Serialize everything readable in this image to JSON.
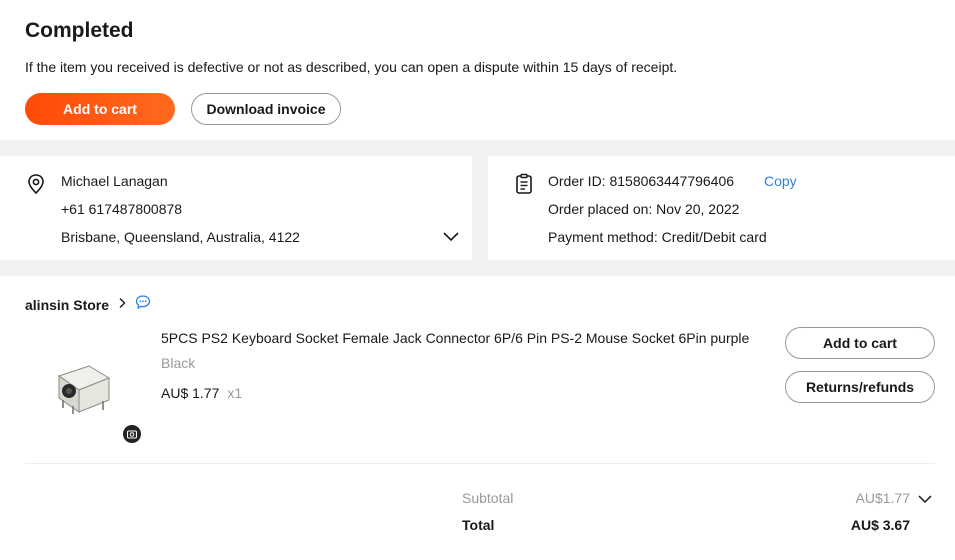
{
  "status": {
    "title": "Completed",
    "description": "If the item you received is defective or not as described, you can open a dispute within 15 days of receipt.",
    "add_to_cart_label": "Add to cart",
    "download_invoice_label": "Download invoice"
  },
  "address": {
    "name": "Michael Lanagan",
    "phone": "+61 617487800878",
    "location": "Brisbane, Queensland, Australia, 4122"
  },
  "order": {
    "order_id": "Order ID: 8158063447796406",
    "copy_label": "Copy",
    "placed_on": "Order placed on: Nov 20, 2022",
    "payment": "Payment method: Credit/Debit card"
  },
  "store": {
    "name": "alinsin Store",
    "chevron": ">"
  },
  "item": {
    "title": "5PCS PS2 Keyboard Socket Female Jack Connector 6P/6 Pin PS-2 Mouse Socket 6Pin purple",
    "variant": "Black",
    "price": "AU$ 1.77",
    "quantity": "x1",
    "add_to_cart_label": "Add to cart",
    "returns_label": "Returns/refunds"
  },
  "summary": {
    "subtotal_label": "Subtotal",
    "subtotal_value": "AU$1.77",
    "total_label": "Total",
    "total_value": "AU$ 3.67"
  },
  "colors": {
    "primary": "#ff4a0a",
    "link": "#2e7fe0",
    "muted": "#999999"
  }
}
